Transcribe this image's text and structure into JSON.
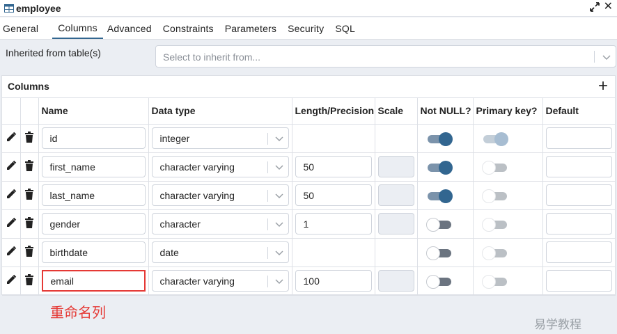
{
  "window": {
    "title": "employee"
  },
  "tabs": [
    "General",
    "Columns",
    "Advanced",
    "Constraints",
    "Parameters",
    "Security",
    "SQL"
  ],
  "active_tab": "Columns",
  "inherit": {
    "label": "Inherited from table(s)",
    "placeholder": "Select to inherit from..."
  },
  "grid": {
    "title": "Columns",
    "headers": [
      "Name",
      "Data type",
      "Length/Precision",
      "Scale",
      "Not NULL?",
      "Primary key?",
      "Default"
    ],
    "rows": [
      {
        "name": "id",
        "type": "integer",
        "length": "",
        "scale": "",
        "not_null": true,
        "primary_key": true,
        "length_enabled": false,
        "pk_enabled": true
      },
      {
        "name": "first_name",
        "type": "character varying",
        "length": "50",
        "scale": "",
        "not_null": true,
        "primary_key": false,
        "length_enabled": true
      },
      {
        "name": "last_name",
        "type": "character varying",
        "length": "50",
        "scale": "",
        "not_null": true,
        "primary_key": false,
        "length_enabled": true
      },
      {
        "name": "gender",
        "type": "character",
        "length": "1",
        "scale": "",
        "not_null": false,
        "primary_key": false,
        "length_enabled": true
      },
      {
        "name": "birthdate",
        "type": "date",
        "length": "",
        "scale": "",
        "not_null": false,
        "primary_key": false,
        "length_enabled": false
      },
      {
        "name": "email",
        "type": "character varying",
        "length": "100",
        "scale": "",
        "not_null": false,
        "primary_key": false,
        "length_enabled": true,
        "highlighted": true
      }
    ]
  },
  "annotation": "重命名列",
  "watermark": "易学教程"
}
